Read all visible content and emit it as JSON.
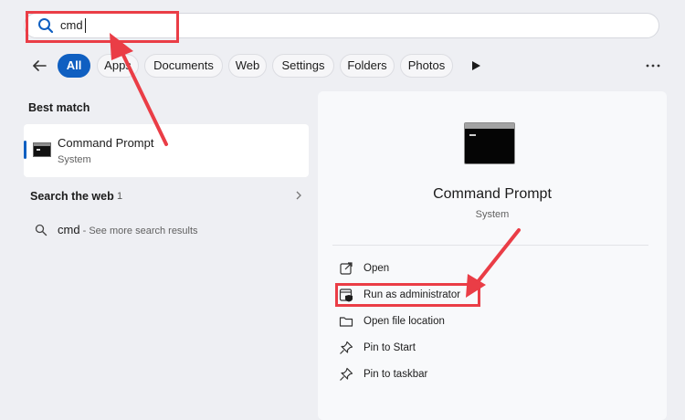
{
  "search": {
    "query": "cmd"
  },
  "filters": [
    "All",
    "Apps",
    "Documents",
    "Web",
    "Settings",
    "Folders",
    "Photos"
  ],
  "left": {
    "best_match_title": "Best match",
    "best_match": {
      "name": "Command Prompt",
      "type": "System"
    },
    "search_web_title": "Search the web",
    "search_web_count": "1",
    "web_result": {
      "query": "cmd",
      "suffix": " - See more search results"
    }
  },
  "details": {
    "name": "Command Prompt",
    "type": "System",
    "actions": [
      {
        "label": "Open",
        "icon": "open-external-icon"
      },
      {
        "label": "Run as administrator",
        "icon": "admin-shield-icon"
      },
      {
        "label": "Open file location",
        "icon": "folder-icon"
      },
      {
        "label": "Pin to Start",
        "icon": "pin-icon"
      },
      {
        "label": "Pin to taskbar",
        "icon": "pin-icon"
      }
    ]
  },
  "colors": {
    "accent": "#0f5fc1",
    "annotation": "#ea3d46",
    "background": "#eeeff3",
    "pane": "#f8f9fb"
  }
}
